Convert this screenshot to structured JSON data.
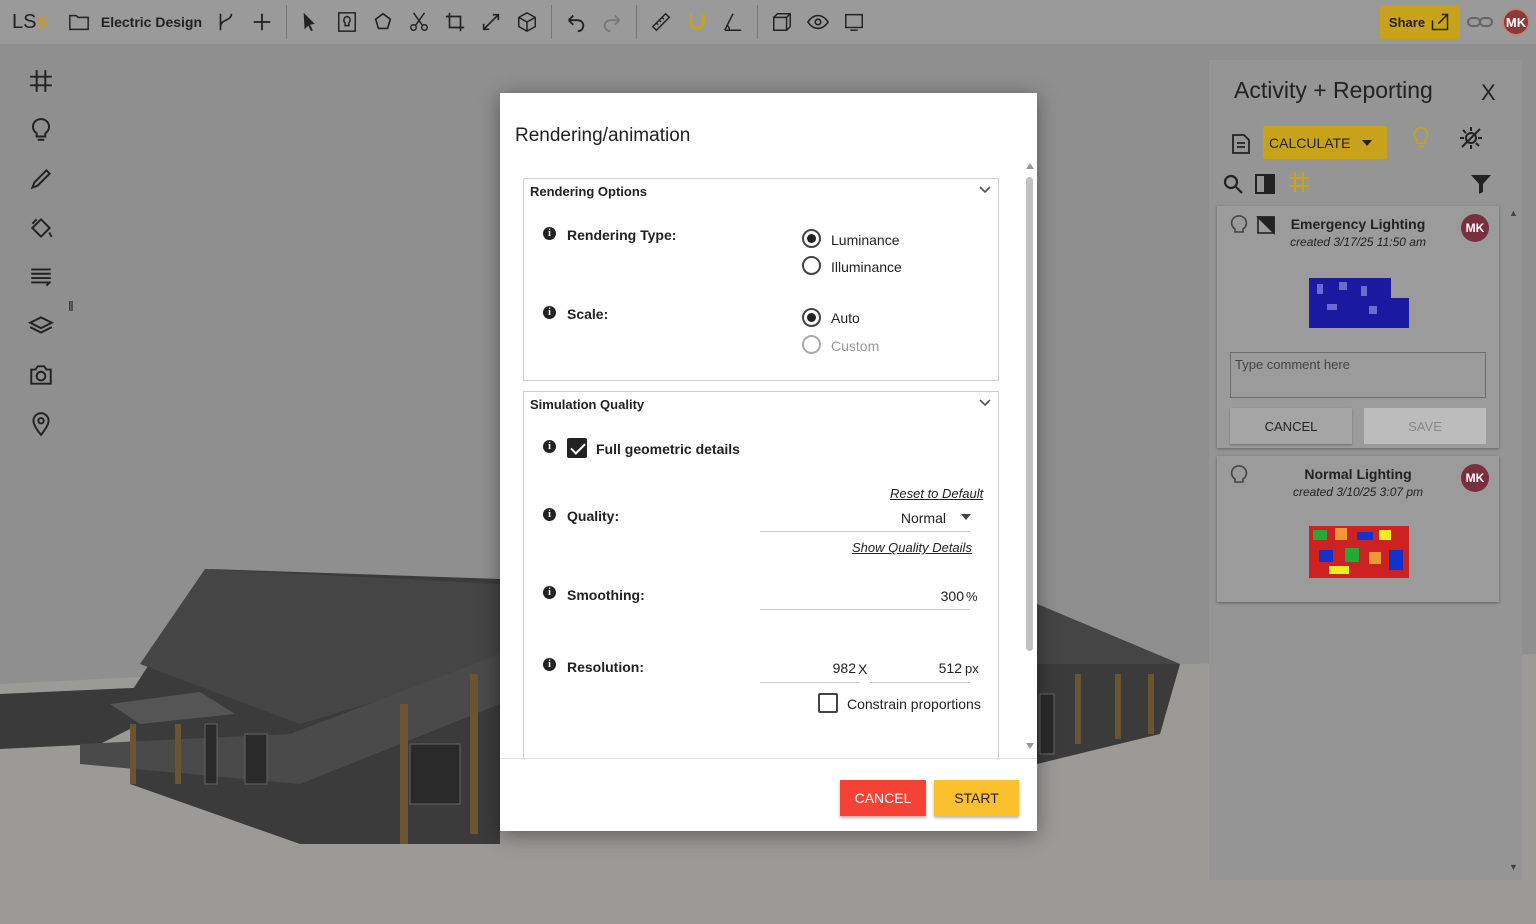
{
  "app": {
    "logo_text": "LS",
    "project_name": "Electric Design"
  },
  "header": {
    "share_label": "Share",
    "user_initials": "MK"
  },
  "colors": {
    "accent": "#c9a21b",
    "cancel_red": "#f44336",
    "start_yellow": "#fbc02d",
    "avatar": "#7a2f3f"
  },
  "left_sidebar": {
    "icons": [
      "grid-icon",
      "bulb-icon",
      "pencil-icon",
      "paint-bucket-icon",
      "list-icon",
      "layers-icon",
      "camera-icon",
      "location-pin-icon"
    ]
  },
  "right_panel": {
    "title": "Activity + Reporting",
    "close_label": "X",
    "calculate_label": "CALCULATE",
    "cards": [
      {
        "title": "Emergency Lighting",
        "created": "created 3/17/25 11:50 am",
        "initials": "MK",
        "comment_placeholder": "Type comment here",
        "cancel_label": "CANCEL",
        "save_label": "SAVE"
      },
      {
        "title": "Normal Lighting",
        "created": "created 3/10/25 3:07 pm",
        "initials": "MK"
      }
    ]
  },
  "modal": {
    "title": "Rendering/animation",
    "rendering_options": {
      "heading": "Rendering Options",
      "rendering_type_label": "Rendering Type:",
      "rendering_type_options": [
        "Luminance",
        "Illuminance"
      ],
      "rendering_type_selected": "Luminance",
      "scale_label": "Scale:",
      "scale_options": [
        "Auto",
        "Custom"
      ],
      "scale_selected": "Auto"
    },
    "simulation_quality": {
      "heading": "Simulation Quality",
      "full_geometric_label": "Full geometric details",
      "full_geometric_checked": true,
      "reset_link": "Reset to Default",
      "quality_label": "Quality:",
      "quality_value": "Normal",
      "show_details_link": "Show Quality Details",
      "smoothing_label": "Smoothing:",
      "smoothing_value": "300",
      "smoothing_unit": "%",
      "resolution_label": "Resolution:",
      "resolution_width": "982",
      "resolution_x": "X",
      "resolution_height": "512",
      "resolution_unit": "px",
      "constrain_label": "Constrain proportions",
      "constrain_checked": false
    },
    "cancel_label": "CANCEL",
    "start_label": "START"
  }
}
